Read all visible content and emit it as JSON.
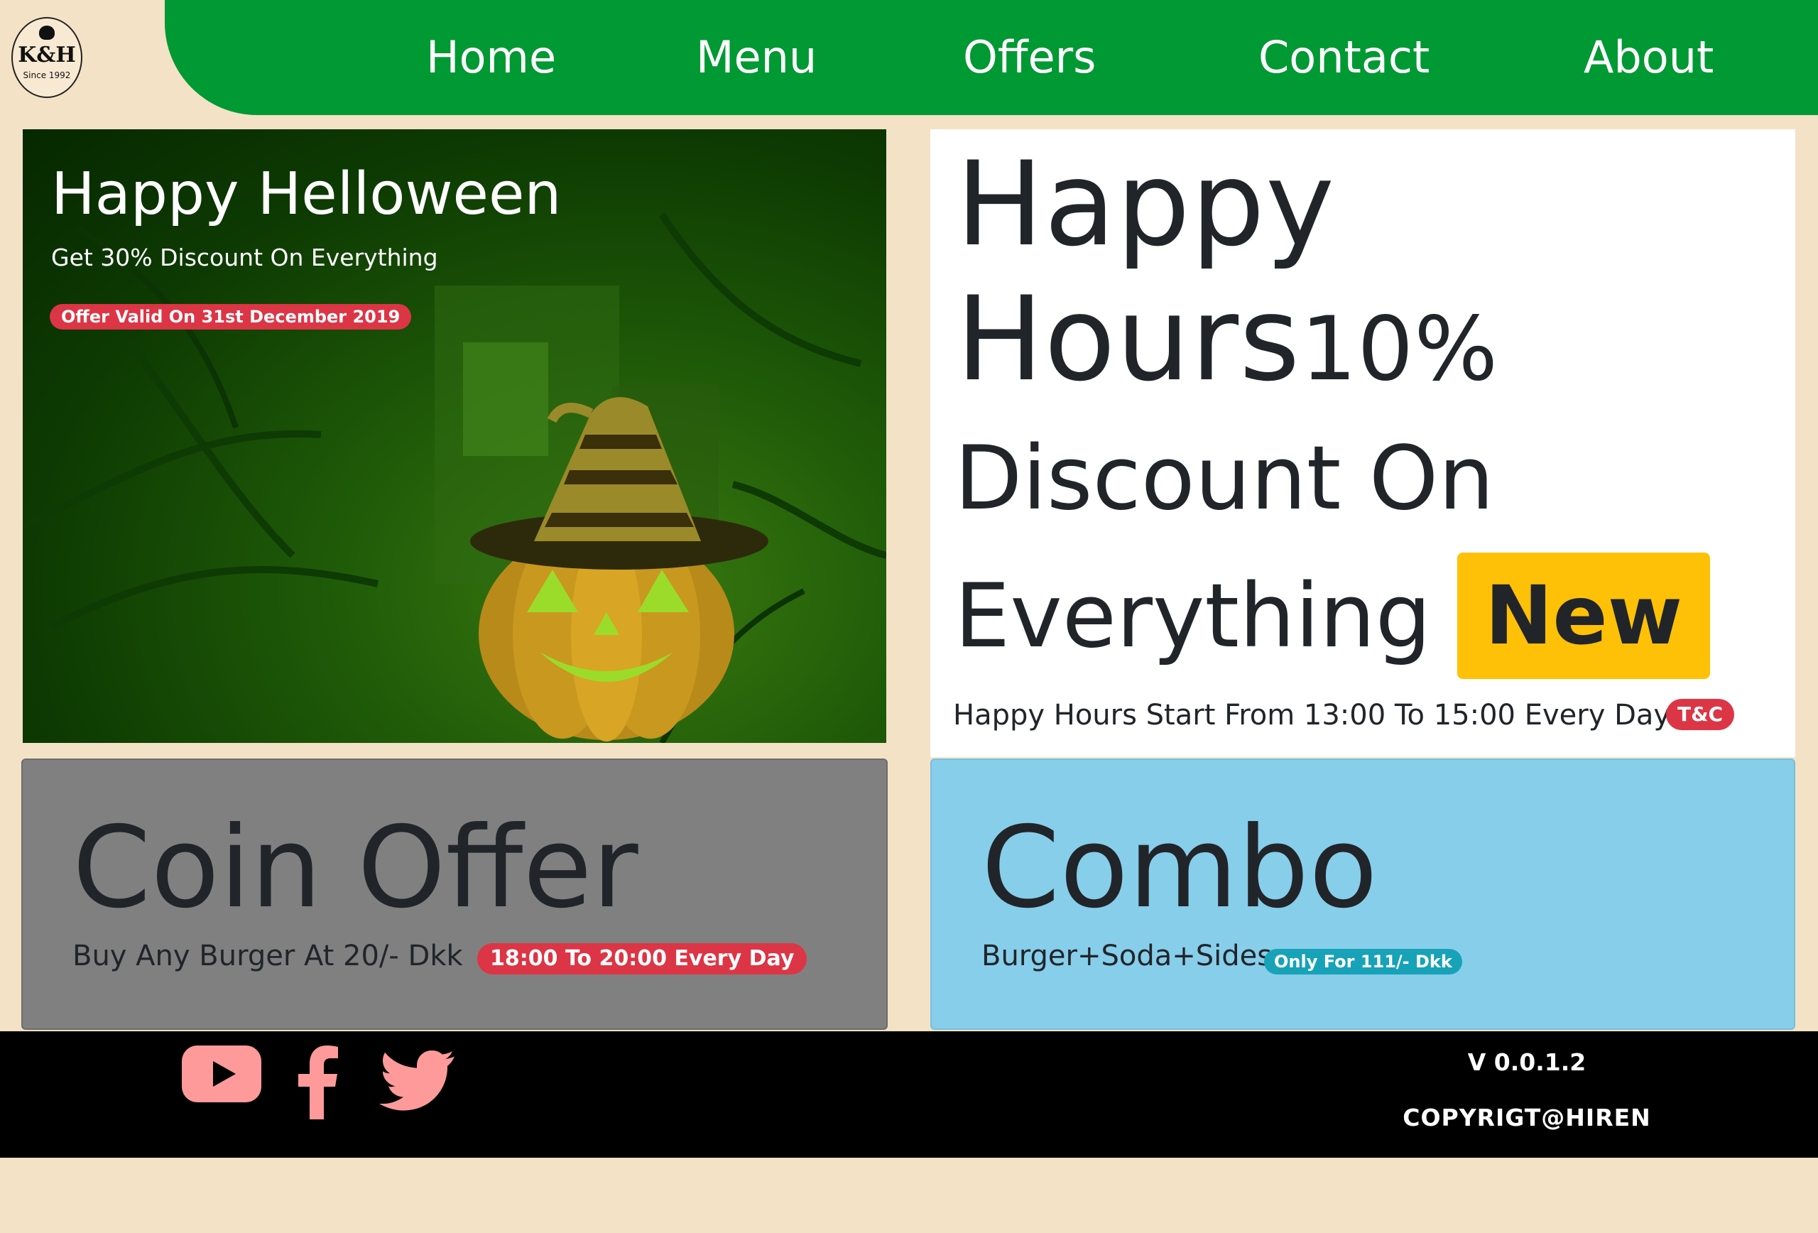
{
  "nav": {
    "logo": {
      "monogram": "K&H",
      "since": "Since 1992"
    },
    "items": [
      {
        "label": "Home"
      },
      {
        "label": "Menu"
      },
      {
        "label": "Offers"
      },
      {
        "label": "Contact"
      },
      {
        "label": "About"
      }
    ]
  },
  "offers": {
    "halloween": {
      "title": "Happy Helloween",
      "subtitle": "Get 30% Discount On Everything",
      "badge": "Offer Valid On 31st December 2019"
    },
    "happy_hours": {
      "line1": "Happy",
      "line2_title": "Hours",
      "line2_percent": "10%",
      "line3": "Discount On",
      "line4": "Everything",
      "new_badge": "New",
      "detail": "Happy Hours Start From 13:00 To 15:00 Every Day",
      "tc_badge": "T&C"
    },
    "coin": {
      "title": "Coin Offer",
      "detail": "Buy Any Burger At 20/- Dkk",
      "badge": "18:00 To 20:00 Every Day"
    },
    "combo": {
      "title": "Combo",
      "detail": "Burger+Soda+Sides",
      "badge": "Only For 111/- Dkk"
    }
  },
  "footer": {
    "social": [
      "youtube-icon",
      "facebook-icon",
      "twitter-icon"
    ],
    "version": "V 0.0.1.2",
    "copyright": "COPYRIGT@HIREN"
  },
  "colors": {
    "nav": "#009933",
    "background": "#f4e2c6",
    "badge_red": "#dc3545",
    "badge_yellow": "#ffc107",
    "badge_teal": "#17a2b8",
    "combo_card": "#87ceeb",
    "coin_card": "#808080",
    "social_icons": "#ff9a9a"
  }
}
